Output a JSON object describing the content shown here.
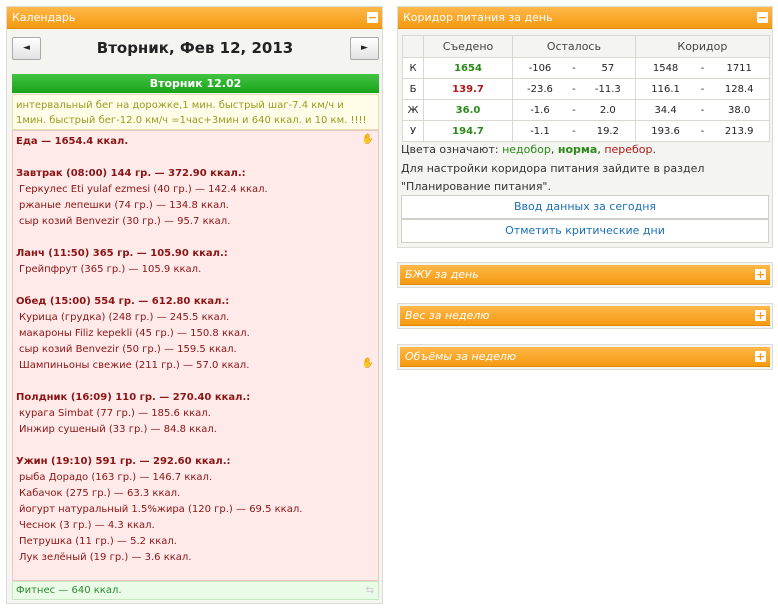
{
  "calendar": {
    "title": "Календарь",
    "toggle": "−",
    "prev": "◄",
    "next": "►",
    "date": "Вторник, Фев 12, 2013",
    "day_label": "Вторник 12.02",
    "note": "интервальный бег на дорожке,1 мин. быстрый шаг-7.4 км/ч и 1мин. быстрый бег-12.0 км/ч =1час+3мин и 640 ккал. и 10 км. !!!!",
    "meals": [
      {
        "text": "Еда — 1654.4 ккал.",
        "bold": true
      },
      {
        "text": "",
        "spacer": true
      },
      {
        "text": "Завтрак (08:00) 144 гр. — 372.90 ккал.:",
        "bold": true
      },
      {
        "text": "Геркулес Eti yulaf ezmesi (40 гр.) — 142.4 ккал."
      },
      {
        "text": "ржаные лепешки (74 гр.) — 134.8 ккал."
      },
      {
        "text": "сыр козий Benvezir (30 гр.) — 95.7 ккал."
      },
      {
        "text": "",
        "spacer": true
      },
      {
        "text": "Ланч (11:50) 365 гр. — 105.90 ккал.:",
        "bold": true
      },
      {
        "text": "Грейпфрут (365 гр.) — 105.9 ккал."
      },
      {
        "text": "",
        "spacer": true
      },
      {
        "text": "Обед (15:00) 554 гр. — 612.80 ккал.:",
        "bold": true
      },
      {
        "text": "Курица (грудка) (248 гр.) — 245.5 ккал."
      },
      {
        "text": "макароны Filiz kepekli (45 гр.) — 150.8 ккал."
      },
      {
        "text": "сыр козий Benvezir (50 гр.) — 159.5 ккал."
      },
      {
        "text": "Шампиньоны свежие (211 гр.) — 57.0 ккал."
      },
      {
        "text": "",
        "spacer": true
      },
      {
        "text": "Полдник (16:09) 110 гр. — 270.40 ккал.:",
        "bold": true
      },
      {
        "text": "курага Simbat (77 гр.) — 185.6 ккал."
      },
      {
        "text": "Инжир сушеный (33 гр.) — 84.8 ккал."
      },
      {
        "text": "",
        "spacer": true
      },
      {
        "text": "Ужин (19:10) 591 гр. — 292.60 ккал.:",
        "bold": true
      },
      {
        "text": "рыба Дорадо (163 гр.) — 146.7 ккал."
      },
      {
        "text": "Кабачок (275 гр.) — 63.3 ккал."
      },
      {
        "text": "йогурт натуральный 1.5%жира (120 гр.) — 69.5 ккал."
      },
      {
        "text": "Чеснок (3 гр.) — 4.3 ккал."
      },
      {
        "text": "Петрушка (11 гр.) — 5.2 ккал."
      },
      {
        "text": "Лук зелёный (19 гр.) — 3.6 ккал."
      }
    ],
    "fitness": "Фитнес — 640 ккал."
  },
  "corridor": {
    "title": "Коридор питания за день",
    "toggle": "−",
    "headers": [
      "",
      "Съедено",
      "Осталось",
      "Коридор"
    ],
    "rows": [
      {
        "k": "К",
        "eaten": "1654",
        "eaten_cls": "g",
        "rem1": "-106",
        "rem2": "57",
        "c1": "1548",
        "c2": "1711"
      },
      {
        "k": "Б",
        "eaten": "139.7",
        "eaten_cls": "r",
        "rem1": "-23.6",
        "rem2": "-11.3",
        "c1": "116.1",
        "c2": "128.4"
      },
      {
        "k": "Ж",
        "eaten": "36.0",
        "eaten_cls": "g",
        "rem1": "-1.6",
        "rem2": "2.0",
        "c1": "34.4",
        "c2": "38.0"
      },
      {
        "k": "У",
        "eaten": "194.7",
        "eaten_cls": "g",
        "rem1": "-1.1",
        "rem2": "19.2",
        "c1": "193.6",
        "c2": "213.9"
      }
    ],
    "dash": "-",
    "legend_prefix": "Цвета означают:",
    "legend_under": "недобор",
    "legend_norm": "норма",
    "legend_over": "перебор",
    "legend_comma": ",",
    "legend_dot": ".",
    "hint1": "Для настройки коридора питания зайдите в раздел",
    "hint2": "\"Планирование питания\".",
    "btn_today": "Ввод данных за сегодня",
    "btn_critical": "Отметить критические дни",
    "colors": {
      "under": "#2a8a18",
      "norm": "#2a8a18",
      "over": "#b01818"
    }
  },
  "panels": [
    {
      "title": "БЖУ за день",
      "toggle": "+"
    },
    {
      "title": "Вес за неделю",
      "toggle": "+"
    },
    {
      "title": "Объёмы за неделю",
      "toggle": "+"
    }
  ]
}
